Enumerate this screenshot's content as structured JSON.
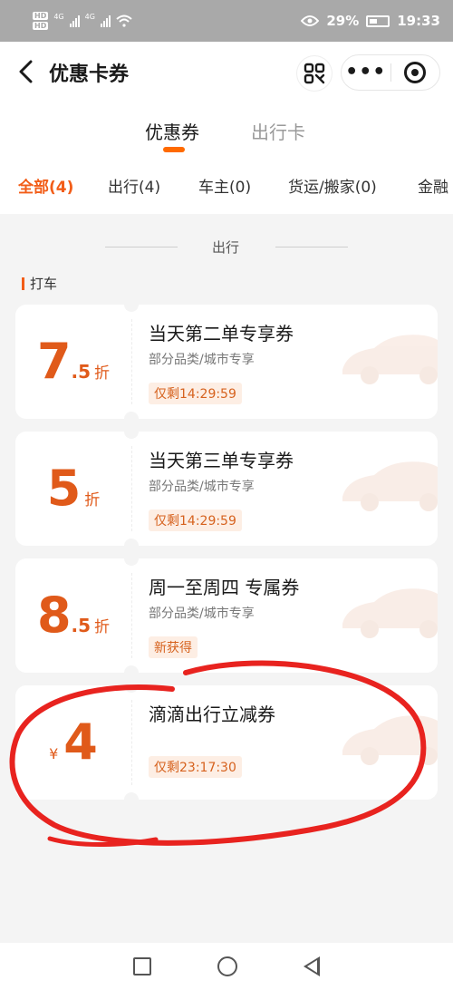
{
  "status_bar": {
    "hd_badges": [
      "HD",
      "HD"
    ],
    "network_left": "4G",
    "network_right": "4G",
    "battery_percent": "29%",
    "time": "19:33"
  },
  "header": {
    "title": "优惠卡券"
  },
  "tabs": [
    {
      "label": "优惠券",
      "active": true
    },
    {
      "label": "出行卡",
      "active": false
    }
  ],
  "categories": [
    {
      "label": "全部(4)",
      "active": true
    },
    {
      "label": "出行(4)",
      "active": false
    },
    {
      "label": "车主(0)",
      "active": false
    },
    {
      "label": "货运/搬家(0)",
      "active": false
    },
    {
      "label": "金融",
      "active": false
    }
  ],
  "section": {
    "label": "出行",
    "subtitle": "打车"
  },
  "coupons": [
    {
      "amount_int": "7",
      "amount_dec": ".5",
      "unit": "折",
      "currency": "",
      "name": "当天第二单专享券",
      "desc": "部分品类/城市专享",
      "tag": "仅剩14:29:59"
    },
    {
      "amount_int": "5",
      "amount_dec": "",
      "unit": "折",
      "currency": "",
      "name": "当天第三单专享券",
      "desc": "部分品类/城市专享",
      "tag": "仅剩14:29:59"
    },
    {
      "amount_int": "8",
      "amount_dec": ".5",
      "unit": "折",
      "currency": "",
      "name": "周一至周四 专属券",
      "desc": "部分品类/城市专享",
      "tag": "新获得"
    },
    {
      "amount_int": "4",
      "amount_dec": "",
      "unit": "",
      "currency": "¥",
      "name": "滴滴出行立减券",
      "desc": "",
      "tag": "仅剩23:17:30"
    }
  ],
  "colors": {
    "accent": "#f25d18",
    "amount": "#e05a1a",
    "annotation": "#e8231f"
  }
}
